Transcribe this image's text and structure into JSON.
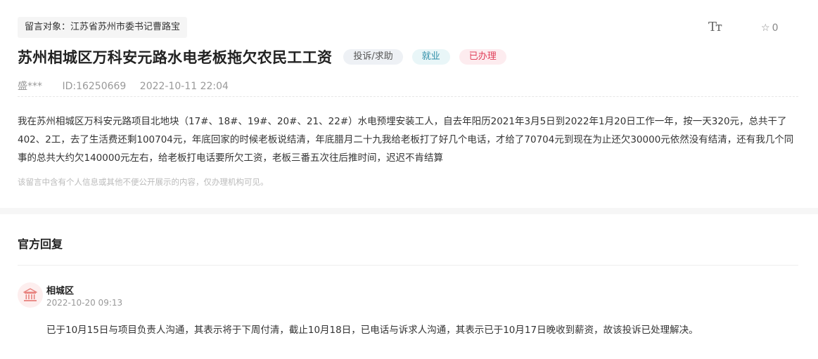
{
  "header": {
    "target": "留言对象：江苏省苏州市委书记曹路宝",
    "font_size_label": "Tт",
    "favorite_icon": "star-outline-icon",
    "favorite_count": "0"
  },
  "message": {
    "title": "苏州相城区万科安元路水电老板拖欠农民工工资",
    "badges": {
      "type": "投诉/求助",
      "field": "就业",
      "status": "已办理"
    },
    "author": "盛***",
    "id": "ID:16250669",
    "datetime": "2022-10-11 22:04",
    "content": "我在苏州相城区万科安元路项目北地块（17#、18#、19#、20#、21、22#）水电预埋安装工人，自去年阳历2021年3月5日到2022年1月20日工作一年，按一天320元，总共干了402、2工，去了生活费还剩100704元，年底回家的时候老板说结清，年底腊月二十九我给老板打了好几个电话，才给了70704元到现在为止还欠30000元依然没有结清，还有我几个同事的总共大约欠140000元左右，给老板打电话要所欠工资，老板三番五次往后推时间，迟迟不肯结算",
    "privacy_note": "该留言中含有个人信息或其他不便公开展示的内容，仅办理机构可见。"
  },
  "reply": {
    "heading": "官方回复",
    "department": "相城区",
    "avatar_icon": "government-building-icon",
    "datetime": "2022-10-20 09:13",
    "content": "已于10月15日与项目负责人沟通，其表示将于下周付清，截止10月18日，已电话与诉求人沟通，其表示已于10月17日晚收到薪资，故该投诉已处理解决。"
  },
  "colors": {
    "status_red": "#e0405a",
    "field_teal": "#2f8ea8",
    "avatar_bg": "#fdeeee"
  }
}
